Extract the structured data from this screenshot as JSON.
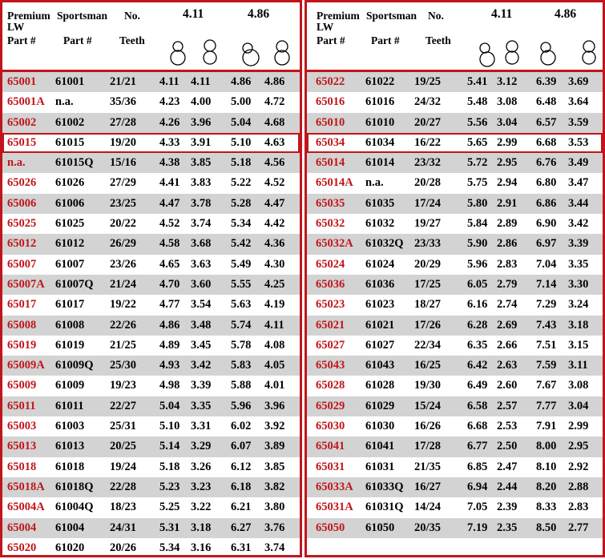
{
  "colors": {
    "accent": "#c0151b",
    "shade": "#d3d3d3"
  },
  "header": {
    "premium": "Premium",
    "lw": "LW",
    "part_left": "Part #",
    "sportsman": "Sportsman",
    "part_mid": "Part #",
    "no": "No.",
    "teeth": "Teeth",
    "ratio_a": "4.11",
    "ratio_b": "4.86",
    "icons": [
      "small-gear-ring-icon",
      "large-gear-ring-icon",
      "small-gear-ring-icon",
      "large-gear-ring-icon"
    ]
  },
  "left_rows": [
    [
      "65001",
      "61001",
      "21/21",
      "4.11",
      "4.11",
      "4.86",
      "4.86"
    ],
    [
      "65001A",
      "n.a.",
      "35/36",
      "4.23",
      "4.00",
      "5.00",
      "4.72"
    ],
    [
      "65002",
      "61002",
      "27/28",
      "4.26",
      "3.96",
      "5.04",
      "4.68"
    ],
    [
      "65015",
      "61015",
      "19/20",
      "4.33",
      "3.91",
      "5.10",
      "4.63"
    ],
    [
      "n.a.",
      "61015Q",
      "15/16",
      "4.38",
      "3.85",
      "5.18",
      "4.56"
    ],
    [
      "65026",
      "61026",
      "27/29",
      "4.41",
      "3.83",
      "5.22",
      "4.52"
    ],
    [
      "65006",
      "61006",
      "23/25",
      "4.47",
      "3.78",
      "5.28",
      "4.47"
    ],
    [
      "65025",
      "61025",
      "20/22",
      "4.52",
      "3.74",
      "5.34",
      "4.42"
    ],
    [
      "65012",
      "61012",
      "26/29",
      "4.58",
      "3.68",
      "5.42",
      "4.36"
    ],
    [
      "65007",
      "61007",
      "23/26",
      "4.65",
      "3.63",
      "5.49",
      "4.30"
    ],
    [
      "65007A",
      "61007Q",
      "21/24",
      "4.70",
      "3.60",
      "5.55",
      "4.25"
    ],
    [
      "65017",
      "61017",
      "19/22",
      "4.77",
      "3.54",
      "5.63",
      "4.19"
    ],
    [
      "65008",
      "61008",
      "22/26",
      "4.86",
      "3.48",
      "5.74",
      "4.11"
    ],
    [
      "65019",
      "61019",
      "21/25",
      "4.89",
      "3.45",
      "5.78",
      "4.08"
    ],
    [
      "65009A",
      "61009Q",
      "25/30",
      "4.93",
      "3.42",
      "5.83",
      "4.05"
    ],
    [
      "65009",
      "61009",
      "19/23",
      "4.98",
      "3.39",
      "5.88",
      "4.01"
    ],
    [
      "65011",
      "61011",
      "22/27",
      "5.04",
      "3.35",
      "5.96",
      "3.96"
    ],
    [
      "65003",
      "61003",
      "25/31",
      "5.10",
      "3.31",
      "6.02",
      "3.92"
    ],
    [
      "65013",
      "61013",
      "20/25",
      "5.14",
      "3.29",
      "6.07",
      "3.89"
    ],
    [
      "65018",
      "61018",
      "19/24",
      "5.18",
      "3.26",
      "6.12",
      "3.85"
    ],
    [
      "65018A",
      "61018Q",
      "22/28",
      "5.23",
      "3.23",
      "6.18",
      "3.82"
    ],
    [
      "65004A",
      "61004Q",
      "18/23",
      "5.25",
      "3.22",
      "6.21",
      "3.80"
    ],
    [
      "65004",
      "61004",
      "24/31",
      "5.31",
      "3.18",
      "6.27",
      "3.76"
    ],
    [
      "65020",
      "61020",
      "20/26",
      "5.34",
      "3.16",
      "6.31",
      "3.74"
    ]
  ],
  "right_rows": [
    [
      "65022",
      "61022",
      "19/25",
      "5.41",
      "3.12",
      "6.39",
      "3.69"
    ],
    [
      "65016",
      "61016",
      "24/32",
      "5.48",
      "3.08",
      "6.48",
      "3.64"
    ],
    [
      "65010",
      "61010",
      "20/27",
      "5.56",
      "3.04",
      "6.57",
      "3.59"
    ],
    [
      "65034",
      "61034",
      "16/22",
      "5.65",
      "2.99",
      "6.68",
      "3.53"
    ],
    [
      "65014",
      "61014",
      "23/32",
      "5.72",
      "2.95",
      "6.76",
      "3.49"
    ],
    [
      "65014A",
      "n.a.",
      "20/28",
      "5.75",
      "2.94",
      "6.80",
      "3.47"
    ],
    [
      "65035",
      "61035",
      "17/24",
      "5.80",
      "2.91",
      "6.86",
      "3.44"
    ],
    [
      "65032",
      "61032",
      "19/27",
      "5.84",
      "2.89",
      "6.90",
      "3.42"
    ],
    [
      "65032A",
      "61032Q",
      "23/33",
      "5.90",
      "2.86",
      "6.97",
      "3.39"
    ],
    [
      "65024",
      "61024",
      "20/29",
      "5.96",
      "2.83",
      "7.04",
      "3.35"
    ],
    [
      "65036",
      "61036",
      "17/25",
      "6.05",
      "2.79",
      "7.14",
      "3.30"
    ],
    [
      "65023",
      "61023",
      "18/27",
      "6.16",
      "2.74",
      "7.29",
      "3.24"
    ],
    [
      "65021",
      "61021",
      "17/26",
      "6.28",
      "2.69",
      "7.43",
      "3.18"
    ],
    [
      "65027",
      "61027",
      "22/34",
      "6.35",
      "2.66",
      "7.51",
      "3.15"
    ],
    [
      "65043",
      "61043",
      "16/25",
      "6.42",
      "2.63",
      "7.59",
      "3.11"
    ],
    [
      "65028",
      "61028",
      "19/30",
      "6.49",
      "2.60",
      "7.67",
      "3.08"
    ],
    [
      "65029",
      "61029",
      "15/24",
      "6.58",
      "2.57",
      "7.77",
      "3.04"
    ],
    [
      "65030",
      "61030",
      "16/26",
      "6.68",
      "2.53",
      "7.91",
      "2.99"
    ],
    [
      "65041",
      "61041",
      "17/28",
      "6.77",
      "2.50",
      "8.00",
      "2.95"
    ],
    [
      "65031",
      "61031",
      "21/35",
      "6.85",
      "2.47",
      "8.10",
      "2.92"
    ],
    [
      "65033A",
      "61033Q",
      "16/27",
      "6.94",
      "2.44",
      "8.20",
      "2.88"
    ],
    [
      "65031A",
      "61031Q",
      "14/24",
      "7.05",
      "2.39",
      "8.33",
      "2.83"
    ],
    [
      "65050",
      "61050",
      "20/35",
      "7.19",
      "2.35",
      "8.50",
      "2.77"
    ]
  ]
}
